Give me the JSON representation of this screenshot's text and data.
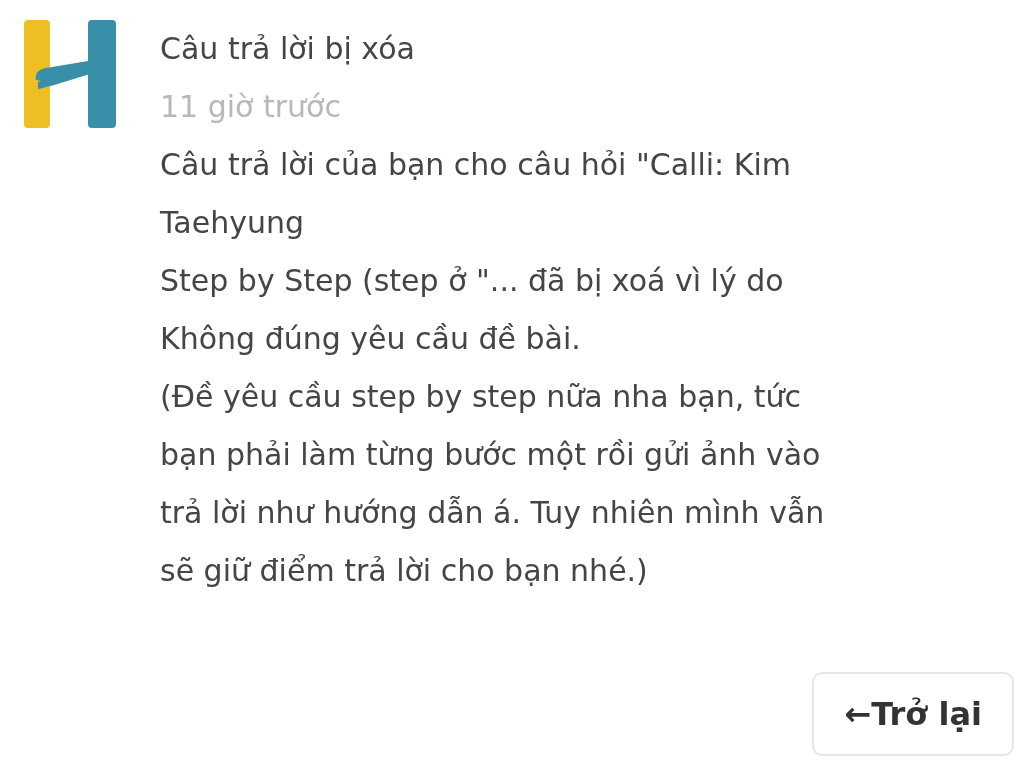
{
  "notification": {
    "title": "Câu trả lời bị xóa",
    "time": "11 giờ trước",
    "message": "Câu trả lời của bạn cho câu hỏi \"Calli: Kim\nTaehyung\nStep by Step (step ở \"... đã bị xoá vì lý do\nKhông đúng yêu cầu đề bài.\n(Đề yêu cầu step by step nữa nha bạn, tức\nbạn phải làm từng bước một rồi gửi ảnh vào\ntrả lời như hướng dẫn á. Tuy nhiên mình vẫn\nsẽ giữ điểm trả lời cho bạn nhé.)"
  },
  "back_button": {
    "label": "←Trở lại"
  }
}
